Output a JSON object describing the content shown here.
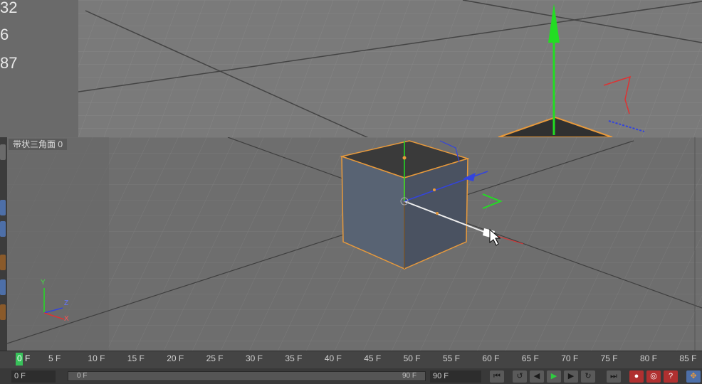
{
  "top_viewport": {
    "stats": [
      "32",
      "6",
      "87"
    ]
  },
  "main_viewport": {
    "label": "带状三角面 0"
  },
  "axis_gizmo": {
    "y": "Y",
    "z": "Z",
    "x": "X"
  },
  "timeline": {
    "current_frame": "0",
    "current_suffix": "F",
    "ticks": [
      "5 F",
      "10 F",
      "15 F",
      "20 F",
      "25 F",
      "30 F",
      "35 F",
      "40 F",
      "45 F",
      "50 F",
      "55 F",
      "60 F",
      "65 F",
      "70 F",
      "75 F",
      "80 F",
      "85 F"
    ]
  },
  "controls": {
    "start_field": "0 F",
    "slider_start": "0 F",
    "slider_end": "90 F",
    "end_field": "90 F",
    "buttons": [
      "go-start",
      "prev-key",
      "prev-frame",
      "play",
      "next-frame",
      "next-key",
      "go-end",
      "record",
      "auto-key",
      "help",
      "move"
    ]
  },
  "colors": {
    "y_axis": "#22dd22",
    "x_axis": "#dd3333",
    "z_axis": "#3344dd",
    "selection": "#e89a3c",
    "play": "#2ecc40"
  }
}
